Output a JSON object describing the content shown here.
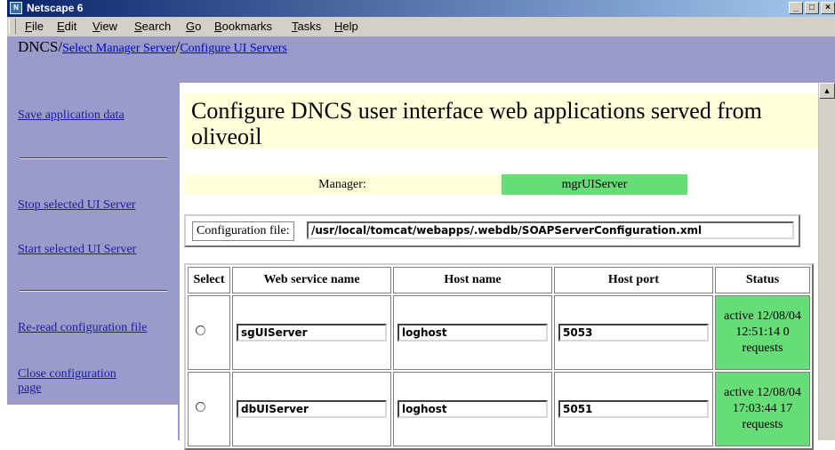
{
  "window": {
    "title": "Netscape 6",
    "icon": "netscape-icon",
    "buttons": [
      "_",
      "□",
      "×"
    ]
  },
  "menubar": {
    "items": [
      "File",
      "Edit",
      "View",
      "Search",
      "Go",
      "Bookmarks",
      "Tasks",
      "Help"
    ]
  },
  "breadcrumb": {
    "root": "DNCS",
    "sep": "/",
    "links": [
      "Select Manager Server",
      "Configure UI Servers"
    ]
  },
  "sidebar": {
    "save": "Save application data",
    "stop": "Stop selected UI Server",
    "start": "Start selected UI Server",
    "reread": "Re-read configuration file",
    "close": "Close configuration page"
  },
  "main": {
    "heading": "Configure DNCS user interface web applications served from oliveoil",
    "manager_label": "Manager:",
    "manager_value": "mgrUIServer",
    "config_label": "Configuration file:",
    "config_value": "/usr/local/tomcat/webapps/.webdb/SOAPServerConfiguration.xml",
    "colors": {
      "status_green": "#66dd77",
      "heading_bg": "#ffffd9",
      "sidebar_bg": "#9b9bc9"
    }
  },
  "table": {
    "headers": [
      "Select",
      "Web service name",
      "Host name",
      "Host port",
      "Status"
    ],
    "rows": [
      {
        "name": "sgUIServer",
        "host": "loghost",
        "port": "5053",
        "status": "active 12/08/04 12:51:14 0 requests"
      },
      {
        "name": "dbUIServer",
        "host": "loghost",
        "port": "5051",
        "status": "active 12/08/04 17:03:44 17 requests"
      }
    ]
  }
}
